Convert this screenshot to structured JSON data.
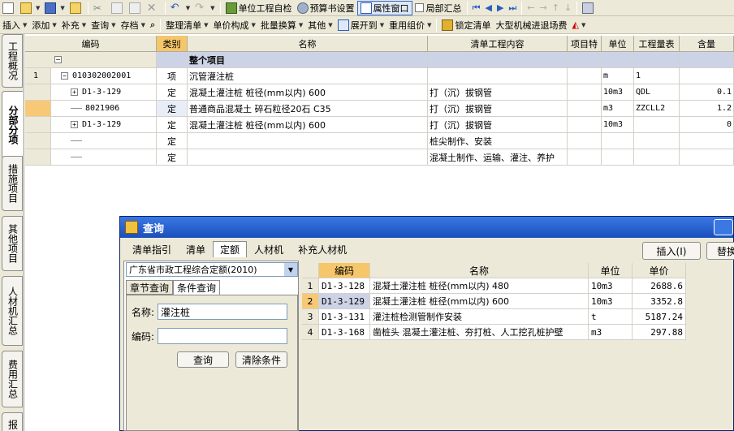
{
  "toolbar1": {
    "items": [
      "单位工程自检",
      "预算书设置",
      "属性窗口",
      "局部汇总"
    ]
  },
  "toolbar2": {
    "items": [
      "插入",
      "添加",
      "补充",
      "查询",
      "存档",
      "整理清单",
      "单价构成",
      "批量换算",
      "其他",
      "展开到",
      "重用组价",
      "锁定清单",
      "大型机械进退场费"
    ]
  },
  "vertical_tabs": [
    "工程概况",
    "分部分项",
    "措施项目",
    "其他项目",
    "人材机汇总",
    "费用汇总",
    "报"
  ],
  "grid": {
    "headers": [
      "编码",
      "类别",
      "名称",
      "清单工程内容",
      "项目特",
      "单位",
      "工程量表",
      "含量"
    ],
    "rows": [
      {
        "num": "",
        "code": "",
        "type": "",
        "name": "整个项目",
        "content": "",
        "unit": "",
        "qty": "",
        "amt": ""
      },
      {
        "num": "1",
        "code": "010302002001",
        "type": "项",
        "name": "沉管灌注桩",
        "content": "",
        "unit": "m",
        "qty": "1",
        "amt": ""
      },
      {
        "num": "",
        "code": "D1-3-129",
        "type": "定",
        "name": "混凝土灌注桩 桩径(mm以内) 600",
        "content": "打（沉）拔钢管",
        "unit": "10m3",
        "qty": "QDL",
        "amt": "0.1"
      },
      {
        "num": "",
        "code": "8021906",
        "type": "定",
        "name": "普通商品混凝土 碎石粒径20石 C35",
        "content": "打（沉）拔钢管",
        "unit": "m3",
        "qty": "ZZCLL2",
        "amt": "1.2"
      },
      {
        "num": "",
        "code": "D1-3-129",
        "type": "定",
        "name": "混凝土灌注桩 桩径(mm以内) 600",
        "content": "打（沉）拔钢管",
        "unit": "10m3",
        "qty": "",
        "amt": "0"
      },
      {
        "num": "",
        "code": "",
        "type": "定",
        "name": "",
        "content": "桩尖制作、安装",
        "unit": "",
        "qty": "",
        "amt": ""
      },
      {
        "num": "",
        "code": "",
        "type": "定",
        "name": "",
        "content": "混凝土制作、运输、灌注、养护",
        "unit": "",
        "qty": "",
        "amt": ""
      }
    ]
  },
  "dialog": {
    "title": "查询",
    "tabs": [
      "清单指引",
      "清单",
      "定额",
      "人材机",
      "补充人材机"
    ],
    "insert_label": "插入(I)",
    "replace_label": "替换",
    "combo_value": "广东省市政工程综合定额(2010)",
    "sub_tabs": [
      "章节查询",
      "条件查询"
    ],
    "name_label": "名称:",
    "name_value": "灌注桩",
    "code_label": "编码:",
    "code_value": "",
    "query_label": "查询",
    "clear_label": "清除条件",
    "result_headers": [
      "编码",
      "名称",
      "单位",
      "单价"
    ],
    "results": [
      {
        "n": "1",
        "code": "D1-3-128",
        "name": "混凝土灌注桩 桩径(mm以内) 480",
        "unit": "10m3",
        "price": "2688.6"
      },
      {
        "n": "2",
        "code": "D1-3-129",
        "name": "混凝土灌注桩 桩径(mm以内) 600",
        "unit": "10m3",
        "price": "3352.8"
      },
      {
        "n": "3",
        "code": "D1-3-131",
        "name": "灌注桩检测管制作安装",
        "unit": "t",
        "price": "5187.24"
      },
      {
        "n": "4",
        "code": "D1-3-168",
        "name": "凿桩头 混凝土灌注桩、夯打桩、人工挖孔桩护壁",
        "unit": "m3",
        "price": "297.88"
      }
    ]
  }
}
